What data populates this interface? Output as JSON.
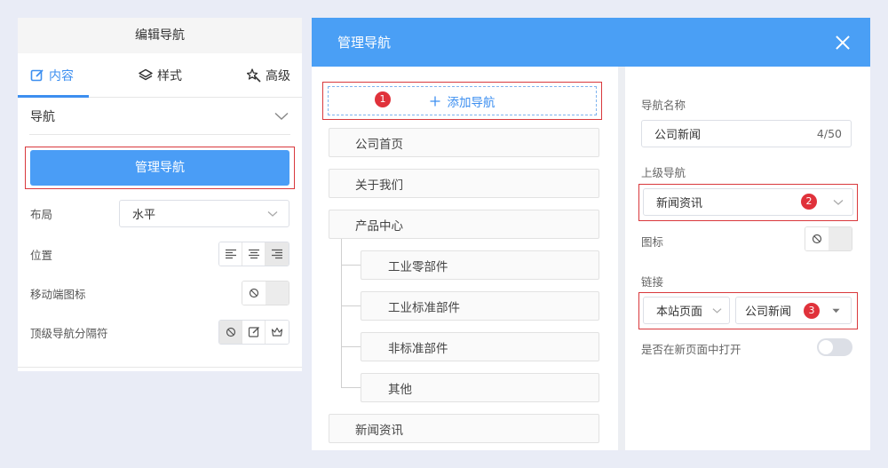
{
  "left_panel": {
    "title": "编辑导航",
    "tabs": [
      {
        "label": "内容",
        "icon": "edit-icon",
        "active": true
      },
      {
        "label": "样式",
        "icon": "layers-icon",
        "active": false
      },
      {
        "label": "高级",
        "icon": "magic-icon",
        "active": false
      }
    ],
    "section_label": "导航",
    "manage_button": "管理导航",
    "layout": {
      "label": "布局",
      "value": "水平"
    },
    "position": {
      "label": "位置",
      "options": [
        "align-left-icon",
        "align-center-icon",
        "align-right-icon"
      ],
      "selected": 2
    },
    "mobile_icon": {
      "label": "移动端图标"
    },
    "separator": {
      "label": "顶级导航分隔符",
      "options": [
        "none-icon",
        "edit-icon",
        "crown-icon"
      ],
      "selected": 0
    }
  },
  "modal": {
    "title": "管理导航",
    "add_nav": {
      "badge": "1",
      "label": "添加导航"
    },
    "nav_items": [
      {
        "label": "公司首页",
        "level": 0
      },
      {
        "label": "关于我们",
        "level": 0
      },
      {
        "label": "产品中心",
        "level": 0
      },
      {
        "label": "工业零部件",
        "level": 1
      },
      {
        "label": "工业标准部件",
        "level": 1
      },
      {
        "label": "非标准部件",
        "level": 1
      },
      {
        "label": "其他",
        "level": 1
      },
      {
        "label": "新闻资讯",
        "level": 0
      }
    ],
    "form": {
      "name_label": "导航名称",
      "name_value": "公司新闻",
      "name_count": "4/50",
      "parent_label": "上级导航",
      "parent_value": "新闻资讯",
      "parent_badge": "2",
      "icon_label": "图标",
      "link_label": "链接",
      "link_type": "本站页面",
      "link_page": "公司新闻",
      "link_badge": "3",
      "new_page_label": "是否在新页面中打开",
      "new_page_on": false
    }
  },
  "colors": {
    "accent": "#4a9ff5",
    "highlight": "#d9383c",
    "background": "#e9ecf6"
  }
}
